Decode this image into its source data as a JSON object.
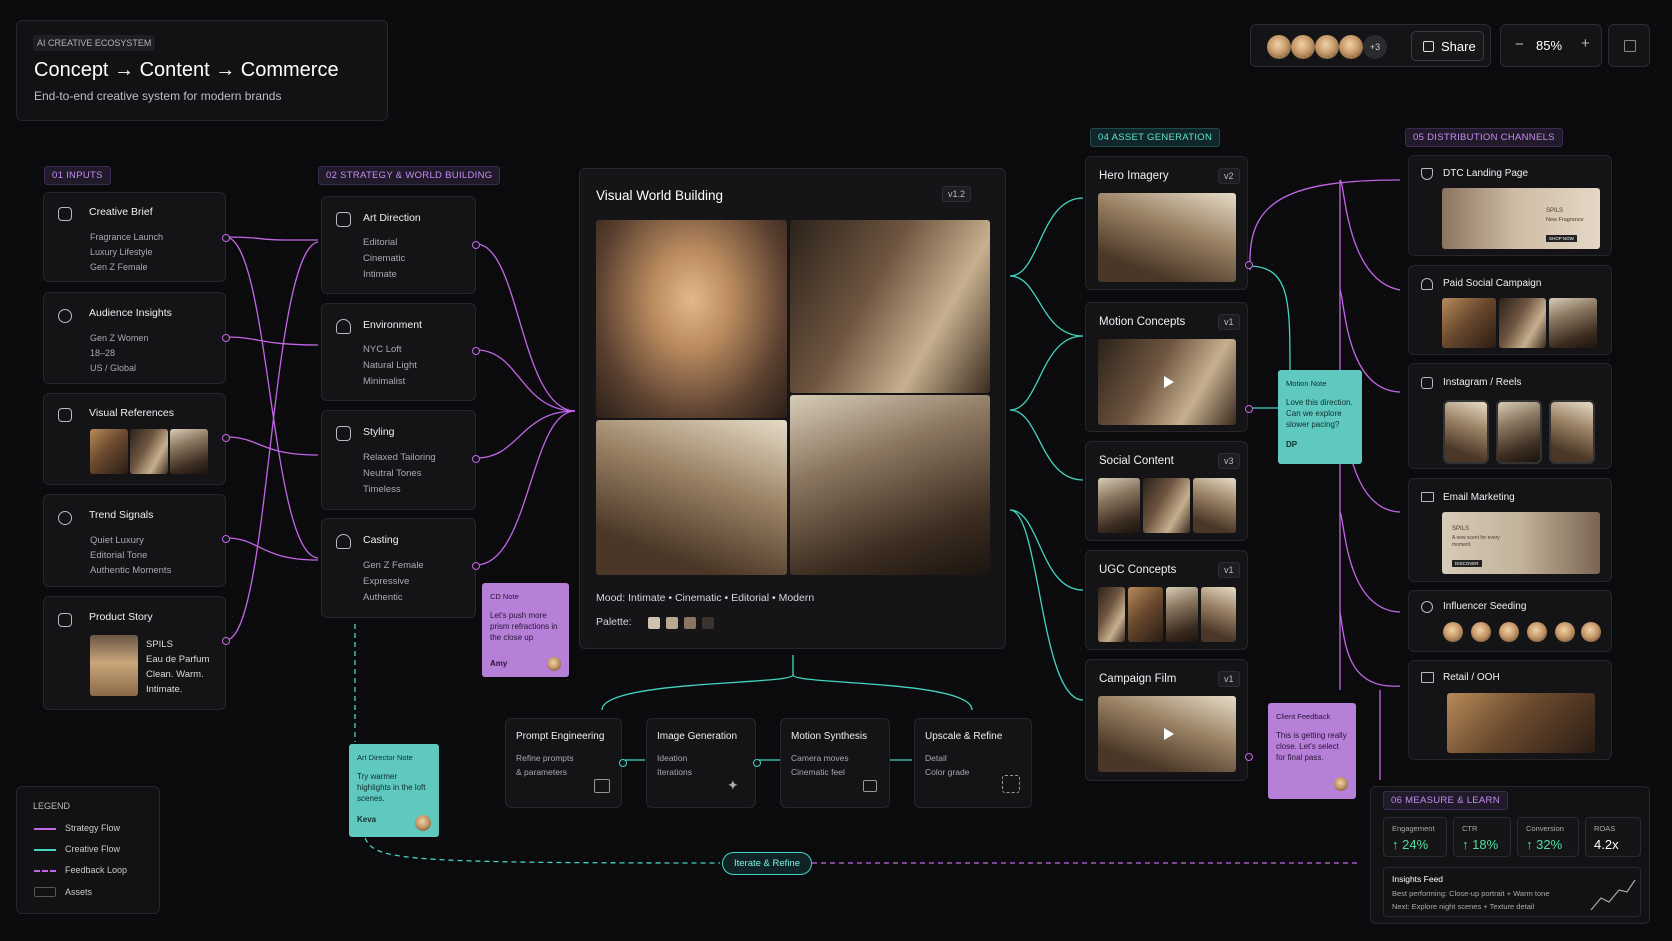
{
  "header": {
    "eyebrow": "AI CREATIVE ECOSYSTEM",
    "title": "Concept → Content → Commerce",
    "subtitle": "End-to-end creative system for modern brands"
  },
  "toolbar": {
    "extra_collaborators": "+3",
    "share_label": "Share",
    "zoom_minus": "−",
    "zoom_level": "85%",
    "zoom_plus": "+"
  },
  "sections": {
    "inputs": "01 INPUTS",
    "strategy": "02 STRATEGY & WORLD BUILDING",
    "asset_generation": "04 ASSET GENERATION",
    "distribution": "05 DISTRIBUTION CHANNELS",
    "measure": "06 MEASURE & LEARN"
  },
  "inputs": [
    {
      "title": "Creative Brief",
      "lines": [
        "Fragrance Launch",
        "Luxury Lifestyle",
        "Gen Z Female"
      ]
    },
    {
      "title": "Audience Insights",
      "lines": [
        "Gen Z Women",
        "18–28",
        "US / Global"
      ]
    },
    {
      "title": "Visual References",
      "lines": []
    },
    {
      "title": "Trend Signals",
      "lines": [
        "Quiet Luxury",
        "Editorial Tone",
        "Authentic Moments"
      ]
    },
    {
      "title": "Product Story",
      "lines": [
        "SPILS",
        "Eau de Parfum",
        "Clean. Warm.",
        "Intimate."
      ]
    }
  ],
  "strategy": [
    {
      "title": "Art Direction",
      "lines": [
        "Editorial",
        "Cinematic",
        "Intimate"
      ]
    },
    {
      "title": "Environment",
      "lines": [
        "NYC Loft",
        "Natural Light",
        "Minimalist"
      ]
    },
    {
      "title": "Styling",
      "lines": [
        "Relaxed Tailoring",
        "Neutral Tones",
        "Timeless"
      ]
    },
    {
      "title": "Casting",
      "lines": [
        "Gen Z Female",
        "Expressive",
        "Authentic"
      ]
    }
  ],
  "world": {
    "title": "Visual World Building",
    "version": "v1.2",
    "mood": "Mood: Intimate • Cinematic • Editorial • Modern",
    "palette_label": "Palette:",
    "palette": [
      "#cfc3b0",
      "#b9a88f",
      "#8a7660",
      "#3a3330"
    ]
  },
  "notes": {
    "cd": {
      "label": "CD Note",
      "text": "Let's push more prism refractions in the close up",
      "author": "Amy"
    },
    "ad": {
      "label": "Art Director Note",
      "text": "Try warmer highlights in the loft scenes.",
      "author": "Keva"
    },
    "motion": {
      "label": "Motion Note",
      "text": "Love this direction. Can we explore slower pacing?",
      "author": "DP"
    },
    "client": {
      "label": "Client Feedback",
      "text": "This is getting really close. Let's select for final pass."
    }
  },
  "pipeline": [
    {
      "title": "Prompt Engineering",
      "lines": [
        "Refine prompts",
        "& parameters"
      ]
    },
    {
      "title": "Image Generation",
      "lines": [
        "Ideation",
        "Iterations"
      ]
    },
    {
      "title": "Motion Synthesis",
      "lines": [
        "Camera moves",
        "Cinematic feel"
      ]
    },
    {
      "title": "Upscale & Refine",
      "lines": [
        "Detail",
        "Color grade"
      ]
    }
  ],
  "iterate_label": "Iterate & Refine",
  "assets": [
    {
      "title": "Hero Imagery",
      "version": "v2"
    },
    {
      "title": "Motion Concepts",
      "version": "v1"
    },
    {
      "title": "Social Content",
      "version": "v3"
    },
    {
      "title": "UGC Concepts",
      "version": "v1"
    },
    {
      "title": "Campaign Film",
      "version": "v1"
    }
  ],
  "channels": [
    {
      "title": "DTC Landing Page",
      "brand": "SPILS",
      "sub": "New Fragrance",
      "cta": "SHOP NOW"
    },
    {
      "title": "Paid Social Campaign"
    },
    {
      "title": "Instagram / Reels"
    },
    {
      "title": "Email Marketing",
      "brand": "SPILS",
      "sub": "A new scent for every moment.",
      "cta": "DISCOVER"
    },
    {
      "title": "Influencer Seeding"
    },
    {
      "title": "Retail / OOH"
    }
  ],
  "metrics": [
    {
      "label": "Engagement",
      "value": "↑ 24%"
    },
    {
      "label": "CTR",
      "value": "↑ 18%"
    },
    {
      "label": "Conversion",
      "value": "↑ 32%"
    },
    {
      "label": "ROAS",
      "value": "4.2x"
    }
  ],
  "insights": {
    "title": "Insights Feed",
    "line1": "Best performing: Close-up portrait + Warm tone",
    "line2": "Next: Explore night scenes + Texture detail"
  },
  "legend": {
    "title": "LEGEND",
    "items": [
      "Strategy Flow",
      "Creative Flow",
      "Feedback Loop",
      "Assets"
    ]
  },
  "colors": {
    "strategy": "#c266e6",
    "creative": "#44d4c2",
    "note_purple": "#b67fd8",
    "note_teal": "#5fc9c0"
  }
}
